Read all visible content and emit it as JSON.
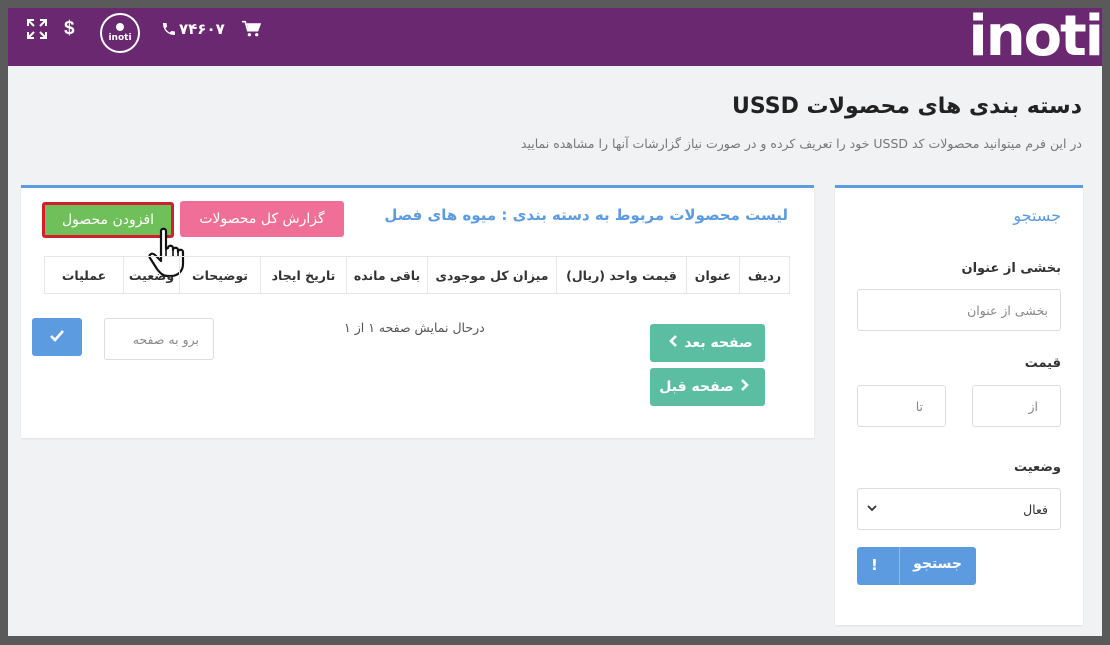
{
  "topbar": {
    "logo": "inoti",
    "phone": "۷۴۶۰۷",
    "avatar_text": "inoti",
    "dollar": "$",
    "icons": [
      "expand-icon",
      "dollar-icon",
      "avatar-icon",
      "phone-icon",
      "cart-icon"
    ]
  },
  "page": {
    "title": "دسته بندی های محصولات USSD",
    "description": "در این فرم میتوانید محصولات کد USSD خود را تعریف کرده و در صورت نیاز گزارشات آنها را مشاهده نمایید"
  },
  "list_panel": {
    "title": "لیست محصولات مربوط به دسته بندی : میوه های فصل",
    "report_button": "گزارش کل محصولات",
    "add_button": "افزودن محصول",
    "columns": [
      "ردیف",
      "عنوان",
      "قیمت واحد (ریال)",
      "میزان کل موجودی",
      "باقی مانده",
      "تاریخ ایجاد",
      "توضیحات",
      "وضعیت",
      "عملیات"
    ],
    "paging_info": "درحال نمایش صفحه ۱ از ۱",
    "next_button": "صفحه بعد",
    "prev_button": "صفحه قبل",
    "goto_placeholder": "برو به صفحه"
  },
  "search_panel": {
    "title": "جستجو",
    "title_label": "بخشی از عنوان",
    "title_placeholder": "بخشی از عنوان",
    "price_label": "قیمت",
    "price_from_placeholder": "از",
    "price_to_placeholder": "تا",
    "status_label": "وضعیت",
    "status_value": "فعال",
    "search_button": "جستجو",
    "search_button_icon": "!"
  },
  "colors": {
    "topbar": "#6a2870",
    "accent_blue": "#5d9be0",
    "pink": "#ef6f98",
    "green": "#6fc05a",
    "teal": "#5bbea2",
    "highlight_red": "#d41c2c"
  }
}
